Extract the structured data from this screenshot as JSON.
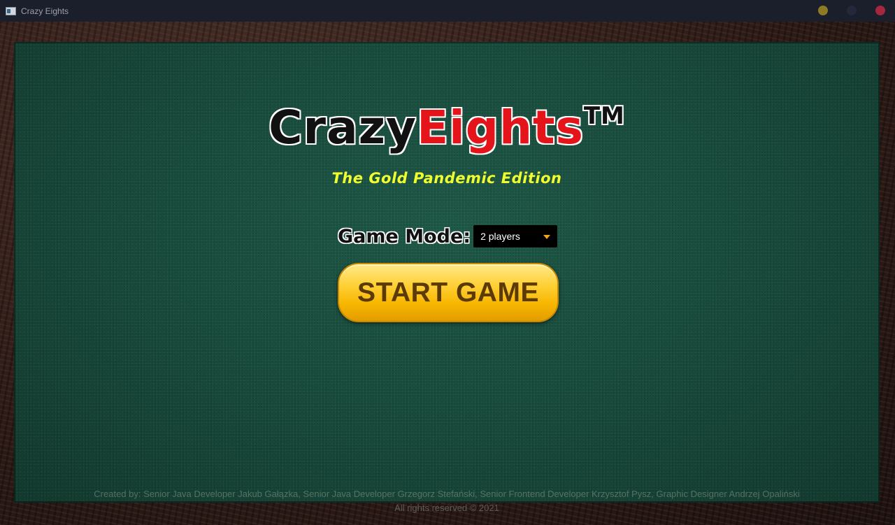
{
  "window": {
    "title": "Crazy Eights",
    "app_icon": "app-window-icon",
    "controls": [
      {
        "name": "minimize",
        "color": "#8c7a25"
      },
      {
        "name": "maximize",
        "color": "#23283a"
      },
      {
        "name": "close",
        "color": "#a3283d"
      }
    ]
  },
  "logo": {
    "crazy": "Crazy",
    "eights": "Eights",
    "tm": "TM",
    "subtitle": "The Gold Pandemic Edition"
  },
  "game_mode": {
    "label": "Game Mode:",
    "selected": "2 players"
  },
  "start_button": {
    "label": "START GAME"
  },
  "footer": {
    "credits": "Created by: Senior Java Developer Jakub Gałązka, Senior Java Developer Grzegorz Stefański, Senior Frontend Developer Krzysztof Pysz, Graphic Designer Andrzej Opaliński",
    "rights": "All rights reserved © 2021"
  },
  "colors": {
    "felt": "#184a3b",
    "eights_red": "#e5141a",
    "subtitle_yellow": "#f0ff2e",
    "button_gold": "#ffd23a",
    "caret_orange": "#f2a413"
  }
}
